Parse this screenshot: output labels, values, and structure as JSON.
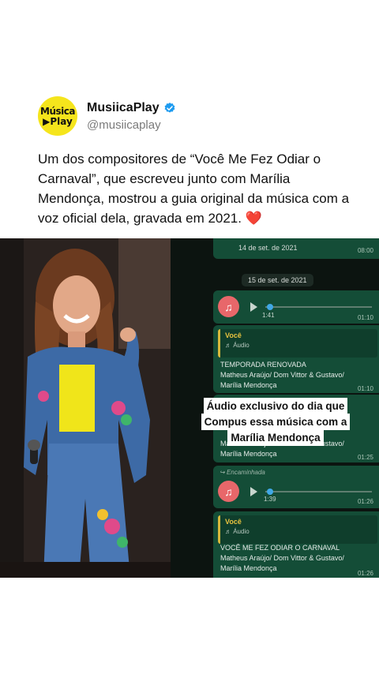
{
  "account": {
    "avatar_line1": "Música",
    "avatar_line2": "▶Play",
    "name": "MusiicaPlay",
    "handle": "@musiicaplay",
    "verified": true
  },
  "tweet": {
    "text": "Um dos compositores de “Você Me Fez Odiar o Carnaval”, que escreveu junto com Marília Mendonça, mostrou a guia original da música com a voz oficial dela, gravada em 2021.",
    "emoji": "❤️"
  },
  "chat": {
    "date_top": "14 de set. de 2021",
    "time_top": "08:00",
    "date_pill": "15 de set. de 2021",
    "audio1": {
      "duration": "1:41",
      "time": "01:10"
    },
    "reply1": {
      "who": "Você",
      "sub": "♬ Áudio",
      "line1": "TEMPORADA RENOVADA",
      "line2": "Matheus Araújo/ Dom Vittor & Gustavo/",
      "line3": "Marília Mendonça",
      "time": "01:10"
    },
    "partial": {
      "line1": "Matheus Araújo/ Dom Vittor & Gustavo/",
      "line2": "Marília Mendonça",
      "time": "01:25"
    },
    "forwarded": {
      "label": "Encaminhada",
      "duration": "1:39",
      "time": "01:26"
    },
    "reply2": {
      "who": "Você",
      "sub": "♬ Áudio",
      "line1": "VOCÊ ME FEZ ODIAR O CARNAVAL",
      "line2": "Matheus Araújo/ Dom Vittor & Gustavo/",
      "line3": "Marília Mendonça",
      "time": "01:26"
    }
  },
  "caption": {
    "line1": "Áudio exclusivo do dia que",
    "line2": "Compus essa música com a",
    "line3": "Marília Mendonça"
  },
  "colors": {
    "avatar_bg": "#f5e51c",
    "verified": "#1d9bf0",
    "chat_bubble": "#144d37",
    "chat_bg": "#0c1410",
    "audio_icon": "#e8676a",
    "quote_accent": "#d6b83c"
  }
}
